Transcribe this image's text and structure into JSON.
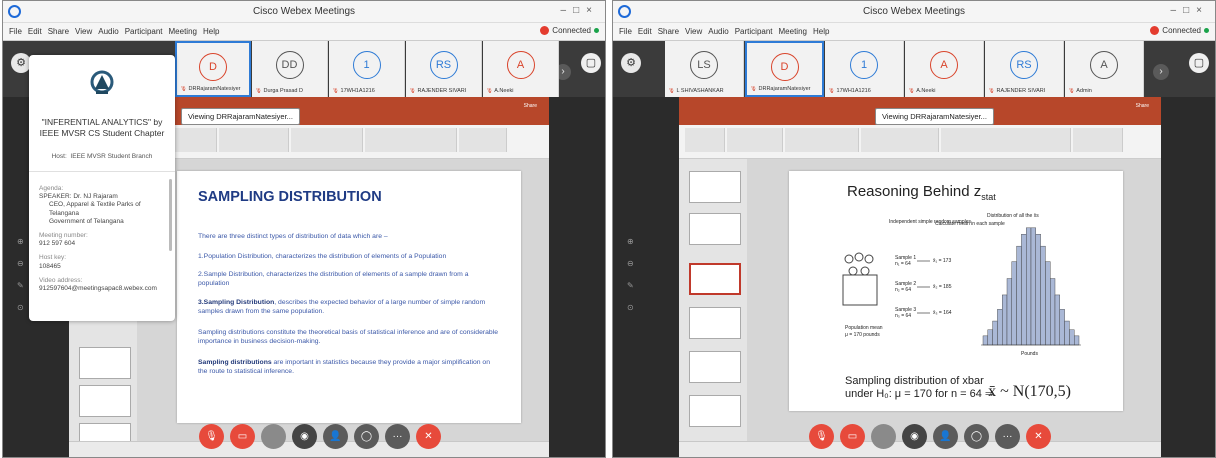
{
  "app": {
    "title": "Cisco Webex Meetings",
    "menu": [
      "File",
      "Edit",
      "Share",
      "View",
      "Audio",
      "Participant",
      "Meeting",
      "Help"
    ],
    "connected": "Connected",
    "viewing": "Viewing DRRajaramNatesiyer..."
  },
  "colors": {
    "accent": "#2e7bd6",
    "pptRed": "#b7472a",
    "leave": "#e74a3b"
  },
  "left": {
    "participants": [
      {
        "initials": "D",
        "name": "DRRajaramNatesiyer",
        "color": "#d9442b",
        "active": true
      },
      {
        "initials": "DD",
        "name": "Durga Prasad D",
        "color": "#555555",
        "active": false
      },
      {
        "initials": "1",
        "name": "17WH1A1216",
        "color": "#2e7bd6",
        "active": false
      },
      {
        "initials": "RS",
        "name": "RAJENDER SIVARI",
        "color": "#2e7bd6",
        "active": false
      },
      {
        "initials": "A",
        "name": "A.Neeki",
        "color": "#d9442b",
        "active": false
      }
    ],
    "info": {
      "title": "\"INFERENTIAL ANALYTICS\" by IEEE MVSR CS Student Chapter",
      "host_label": "Host:",
      "host": "IEEE MVSR Student Branch",
      "agenda_label": "Agenda:",
      "agenda_lines": [
        "SPEAKER: Dr. NJ Rajaram",
        "CEO, Apparel & Textile Parks of Telangana",
        "Government of Telangana"
      ],
      "meeting_number_label": "Meeting number:",
      "meeting_number": "912 597 604",
      "host_key_label": "Host key:",
      "host_key": "108465",
      "video_label": "Video address:",
      "video_address": "912597604@meetingsapac8.webex.com"
    },
    "slide": {
      "title": "SAMPLING DISTRIBUTION",
      "intro": "There are three distinct types of distribution of data which are –",
      "p1": "1.Population Distribution, characterizes the distribution of elements of a Population",
      "p2": "2.Sample Distribution, characterizes the distribution of elements of a sample drawn from a population",
      "p3_bold": "3.Sampling Distribution",
      "p3_rest": ", describes the expected behavior of a large number of simple random samples drawn from the same population.",
      "p4": "Sampling distributions constitute the theoretical basis of statistical inference and are of considerable importance in business decision-making.",
      "p5_bold": "Sampling distributions",
      "p5_rest": " are important in statistics because they provide a major simplification on the route to statistical inference."
    }
  },
  "right": {
    "participants": [
      {
        "initials": "LS",
        "name": "L SHIVASHANKAR",
        "color": "#555555",
        "active": false
      },
      {
        "initials": "D",
        "name": "DRRajaramNatesiyer",
        "color": "#d9442b",
        "active": true
      },
      {
        "initials": "1",
        "name": "17WH1A1216",
        "color": "#2e7bd6",
        "active": false
      },
      {
        "initials": "A",
        "name": "A.Neeki",
        "color": "#d9442b",
        "active": false
      },
      {
        "initials": "RS",
        "name": "RAJENDER SIVARI",
        "color": "#2e7bd6",
        "active": false
      },
      {
        "initials": "A",
        "name": "Admin",
        "color": "#555555",
        "active": false
      }
    ],
    "slide": {
      "title": "Reasoning Behind z",
      "title_sub": "stat",
      "dist_label": "Distribution of all the x̄s",
      "indep": "Independent simple random samples",
      "calc": "Calculate mean in each sample",
      "samples": [
        {
          "label": "Sample 1",
          "n": "n₁ = 64",
          "mean": "x̄₁ = 173"
        },
        {
          "label": "Sample 2",
          "n": "n₂ = 64",
          "mean": "x̄₂ = 185"
        },
        {
          "label": "Sample 3",
          "n": "n₃ = 64",
          "mean": "x̄₃ = 164"
        }
      ],
      "pop": "Population mean",
      "pop_mu": "μ = 170 pounds",
      "axis": "Pounds",
      "sub1": "Sampling distribution of xbar",
      "sub2": "under H₀: μ =  170 for n = 64 ⇒",
      "formula": "x̄ ~ N(170,5)"
    }
  }
}
